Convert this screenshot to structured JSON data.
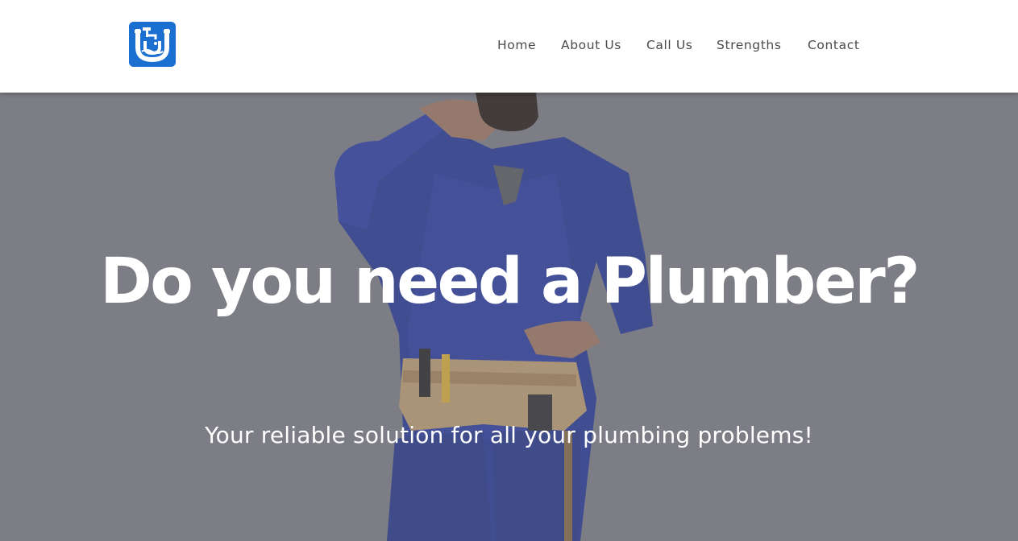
{
  "header": {
    "logo_icon": "plumbing-pipe-logo",
    "brand_color": "#1a6fd1"
  },
  "nav": {
    "items": [
      {
        "label": "Home"
      },
      {
        "label": "About Us"
      },
      {
        "label": "Call Us"
      },
      {
        "label": "Strengths"
      },
      {
        "label": "Contact"
      }
    ]
  },
  "hero": {
    "title": "Do you need a Plumber?",
    "subtitle": "Your reliable solution for all your plumbing problems!",
    "image": "plumber-in-blue-overalls-with-tool-belt",
    "overlay_color": "#808089"
  }
}
